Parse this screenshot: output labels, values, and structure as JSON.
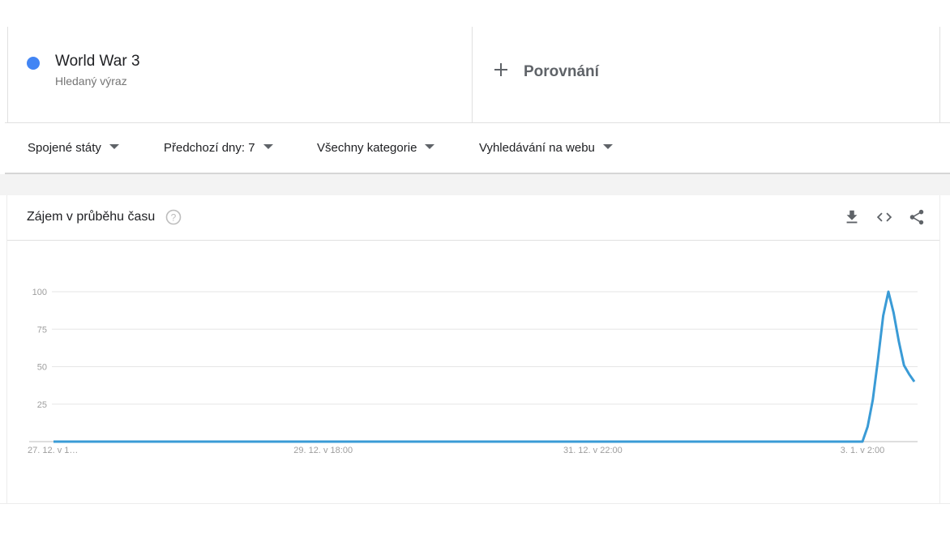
{
  "term": {
    "name": "World War 3",
    "subtitle": "Hledaný výraz",
    "color": "#4285f4"
  },
  "compare": {
    "label": "Porovnání",
    "icon": "plus-icon"
  },
  "filters": [
    {
      "label": "Spojené státy",
      "icon": "caret-down-icon"
    },
    {
      "label": "Předchozí dny: 7",
      "icon": "caret-down-icon"
    },
    {
      "label": "Všechny kategorie",
      "icon": "caret-down-icon"
    },
    {
      "label": "Vyhledávání na webu",
      "icon": "caret-down-icon"
    }
  ],
  "card": {
    "title": "Zájem v průběhu času",
    "help_icon": "help-circle-icon",
    "tools": [
      "download-icon",
      "embed-code-icon",
      "share-icon"
    ]
  },
  "chart_data": {
    "type": "line",
    "title": "",
    "xlabel": "",
    "ylabel": "",
    "ylim": [
      0,
      100
    ],
    "yticks": [
      25,
      50,
      75,
      100
    ],
    "xtick_labels": [
      "27. 12. v 1…",
      "29. 12. v 18:00",
      "31. 12. v 22:00",
      "3. 1. v 2:00"
    ],
    "xtick_index": [
      0,
      52,
      104,
      156
    ],
    "grid": true,
    "series": [
      {
        "color": "#3a9bd6",
        "values": [
          0,
          0,
          0,
          0,
          0,
          0,
          0,
          0,
          0,
          0,
          0,
          0,
          0,
          0,
          0,
          0,
          0,
          0,
          0,
          0,
          0,
          0,
          0,
          0,
          0,
          0,
          0,
          0,
          0,
          0,
          0,
          0,
          0,
          0,
          0,
          0,
          0,
          0,
          0,
          0,
          0,
          0,
          0,
          0,
          0,
          0,
          0,
          0,
          0,
          0,
          0,
          0,
          0,
          0,
          0,
          0,
          0,
          0,
          0,
          0,
          0,
          0,
          0,
          0,
          0,
          0,
          0,
          0,
          0,
          0,
          0,
          0,
          0,
          0,
          0,
          0,
          0,
          0,
          0,
          0,
          0,
          0,
          0,
          0,
          0,
          0,
          0,
          0,
          0,
          0,
          0,
          0,
          0,
          0,
          0,
          0,
          0,
          0,
          0,
          0,
          0,
          0,
          0,
          0,
          0,
          0,
          0,
          0,
          0,
          0,
          0,
          0,
          0,
          0,
          0,
          0,
          0,
          0,
          0,
          0,
          0,
          0,
          0,
          0,
          0,
          0,
          0,
          0,
          0,
          0,
          0,
          0,
          0,
          0,
          0,
          0,
          0,
          0,
          0,
          0,
          0,
          0,
          0,
          0,
          0,
          0,
          0,
          0,
          0,
          0,
          0,
          0,
          0,
          0,
          0,
          0,
          0,
          10,
          28,
          55,
          84,
          100,
          86,
          67,
          51,
          45,
          40
        ]
      }
    ]
  }
}
